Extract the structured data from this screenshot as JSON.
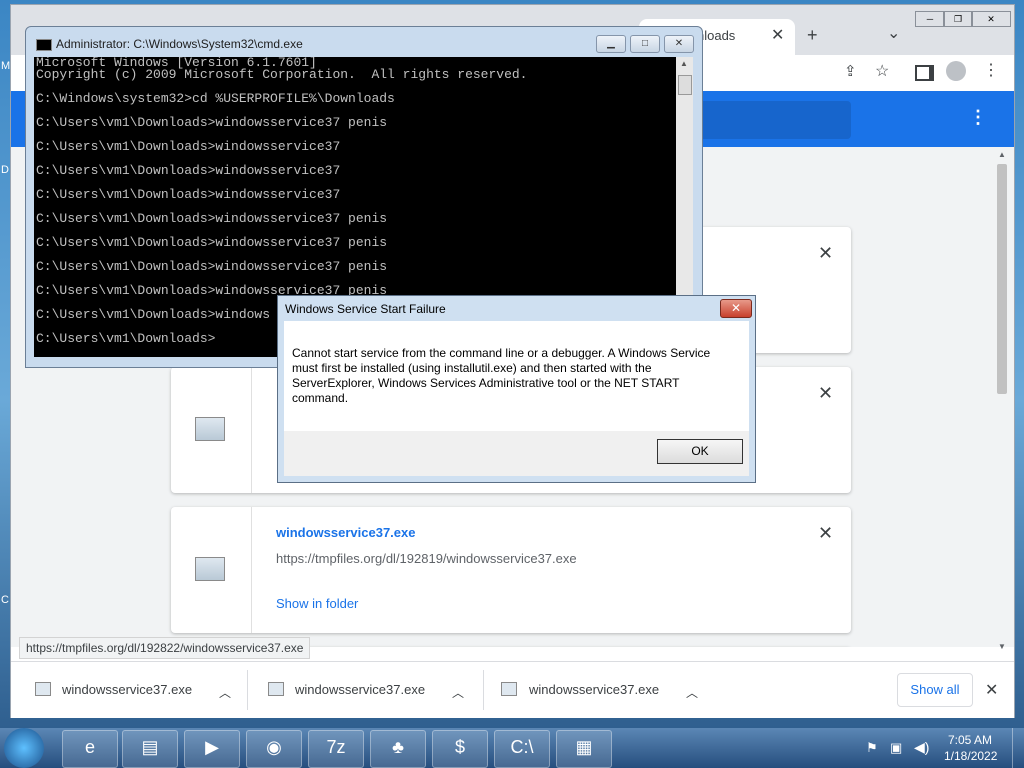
{
  "desktop": {
    "edge_letters": [
      "M",
      "D",
      "C"
    ]
  },
  "chrome": {
    "tab_title": "nloads",
    "new_tab": "+",
    "tab_search": "⌄",
    "window_controls": [
      "─",
      "❐",
      "✕"
    ],
    "toolbar_icons": [
      "share-icon",
      "star-icon",
      "sidepanel-icon",
      "profile-icon",
      "menu-icon"
    ],
    "header_menu": "⋮",
    "cards": [
      {
        "name": "",
        "url": "",
        "show": ""
      },
      {
        "name": "",
        "url": "",
        "show": ""
      },
      {
        "name": "windowsservice37.exe",
        "url": "https://tmpfiles.org/dl/192819/windowsservice37.exe",
        "show": "Show in folder"
      }
    ],
    "status_url": "https://tmpfiles.org/dl/192822/windowsservice37.exe",
    "shelf": {
      "items": [
        "windowsservice37.exe",
        "windowsservice37.exe",
        "windowsservice37.exe"
      ],
      "show_all": "Show all",
      "close": "✕"
    }
  },
  "cmd": {
    "title": "Administrator: C:\\Windows\\System32\\cmd.exe",
    "lines": [
      "Microsoft Windows [Version 6.1.7601]",
      "Copyright (c) 2009 Microsoft Corporation.  All rights reserved.",
      "",
      "C:\\Windows\\system32>cd %USERPROFILE%\\Downloads",
      "",
      "C:\\Users\\vm1\\Downloads>windowsservice37 penis",
      "",
      "C:\\Users\\vm1\\Downloads>windowsservice37",
      "",
      "C:\\Users\\vm1\\Downloads>windowsservice37",
      "",
      "C:\\Users\\vm1\\Downloads>windowsservice37",
      "",
      "C:\\Users\\vm1\\Downloads>windowsservice37 penis",
      "",
      "C:\\Users\\vm1\\Downloads>windowsservice37 penis",
      "",
      "C:\\Users\\vm1\\Downloads>windowsservice37 penis",
      "",
      "C:\\Users\\vm1\\Downloads>windowsservice37 penis",
      "",
      "C:\\Users\\vm1\\Downloads>windows",
      "",
      "C:\\Users\\vm1\\Downloads>"
    ]
  },
  "dialog": {
    "title": "Windows Service Start Failure",
    "message": "Cannot start service from the command line or a debugger.  A Windows Service must first be installed (using installutil.exe) and then started with the ServerExplorer, Windows Services Administrative tool or the NET START command.",
    "ok": "OK",
    "close": "✕"
  },
  "taskbar": {
    "apps": [
      "internet-explorer",
      "file-explorer",
      "media-player",
      "chrome",
      "7zip",
      "money-game",
      "money-bag",
      "cmd",
      "notepad"
    ],
    "app_glyphs": [
      "e",
      "▤",
      "▶",
      "◉",
      "7z",
      "♣",
      "$",
      "C:\\",
      "▦"
    ],
    "time": "7:05 AM",
    "date": "1/18/2022"
  }
}
